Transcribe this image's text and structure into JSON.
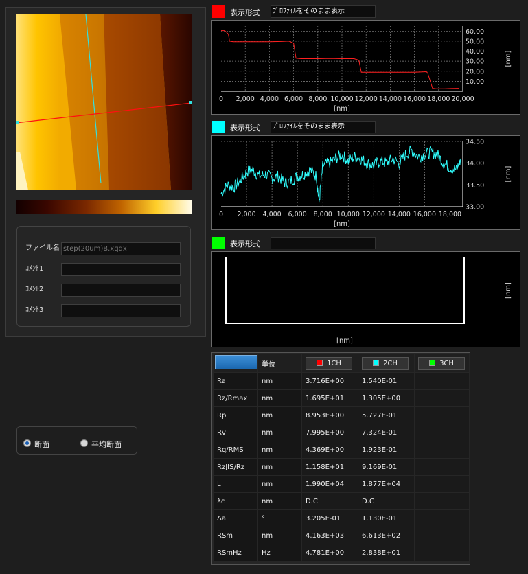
{
  "file_panel": {
    "filename_label": "ファイル名",
    "filename_value": "step(20um)B.xqdx",
    "comment1_label": "ｺﾒﾝﾄ1",
    "comment2_label": "ｺﾒﾝﾄ2",
    "comment3_label": "ｺﾒﾝﾄ3",
    "comment1_value": "",
    "comment2_value": "",
    "comment3_value": ""
  },
  "section_mode": {
    "options": [
      "断面",
      "平均断面"
    ],
    "selected": "断面"
  },
  "channels": [
    {
      "color": "#ff0000",
      "mode_label": "表示形式",
      "mode_value": "ﾌﾟﾛﾌｧｲﾙをそのまま表示",
      "unit": "[nm]",
      "x_unit": "[nm]",
      "x_ticks": [
        "0",
        "2,000",
        "4,000",
        "6,000",
        "8,000",
        "10,000",
        "12,000",
        "14,000",
        "16,000",
        "18,000",
        "20,000"
      ],
      "y_ticks": [
        "60.00",
        "50.00",
        "40.00",
        "30.00",
        "20.00",
        "10.00"
      ]
    },
    {
      "color": "#00ffff",
      "mode_label": "表示形式",
      "mode_value": "ﾌﾟﾛﾌｧｲﾙをそのまま表示",
      "unit": "[nm]",
      "x_unit": "[nm]",
      "x_ticks": [
        "0",
        "2,000",
        "4,000",
        "6,000",
        "8,000",
        "10,000",
        "12,000",
        "14,000",
        "16,000",
        "18,000"
      ],
      "y_ticks": [
        "34.50",
        "34.00",
        "33.50",
        "33.00"
      ]
    },
    {
      "color": "#00ff00",
      "mode_label": "表示形式",
      "mode_value": "",
      "unit": "[nm]",
      "x_unit": "[nm]"
    }
  ],
  "chart_data": [
    {
      "type": "line",
      "series": [
        {
          "x": [
            0,
            300,
            600,
            700,
            1000,
            2000,
            3000,
            4000,
            5000,
            5600,
            6000,
            6200,
            6600,
            8000,
            9000,
            10000,
            11000,
            11400,
            11600,
            12000,
            14000,
            16000,
            17000,
            17100,
            17500,
            17800,
            18500,
            19000,
            19700
          ],
          "y": [
            60.5,
            60.5,
            57,
            50,
            49.5,
            49.5,
            49.5,
            49.5,
            49.7,
            50,
            48,
            33,
            32.5,
            32.5,
            32.8,
            32.5,
            32.5,
            31,
            19,
            19,
            19,
            19,
            19.5,
            18,
            3,
            2.5,
            2.6,
            2.8,
            3
          ]
        }
      ],
      "xlim": [
        0,
        20000
      ],
      "ylim": [
        0,
        65
      ]
    },
    {
      "type": "line",
      "series": [
        {
          "x": [
            0,
            500,
            1000,
            1500,
            2000,
            2500,
            3000,
            3500,
            4000,
            4500,
            5000,
            5500,
            6000,
            6500,
            7000,
            7500,
            7700,
            8000,
            8500,
            9000,
            9500,
            10000,
            10500,
            11000,
            11500,
            12000,
            12500,
            13000,
            13500,
            14000,
            14500,
            15000,
            15500,
            16000,
            16500,
            17000,
            17500,
            18000,
            18500,
            18900
          ],
          "y": [
            33.3,
            33.5,
            33.45,
            33.6,
            33.8,
            33.85,
            33.7,
            33.75,
            33.65,
            33.7,
            33.55,
            33.6,
            33.7,
            33.75,
            33.85,
            33.7,
            33.1,
            33.95,
            34.0,
            34.1,
            34.2,
            34.05,
            34.15,
            34.1,
            34.0,
            33.95,
            34.05,
            34.0,
            34.1,
            34.0,
            34.2,
            34.3,
            34.15,
            34.2,
            34.25,
            34.2,
            34.0,
            33.9,
            33.85,
            34.1
          ]
        }
      ],
      "xlim": [
        0,
        19000
      ],
      "ylim": [
        33.0,
        34.5
      ]
    },
    {
      "type": "line",
      "series": []
    }
  ],
  "table": {
    "header": [
      "",
      "単位",
      "1CH",
      "2CH",
      "3CH"
    ],
    "header_colors": [
      "",
      "",
      "#ff0000",
      "#00ffff",
      "#00ff00"
    ],
    "rows": [
      [
        "Ra",
        "nm",
        "3.716E+00",
        "1.540E-01",
        ""
      ],
      [
        "Rz/Rmax",
        "nm",
        "1.695E+01",
        "1.305E+00",
        ""
      ],
      [
        "Rp",
        "nm",
        "8.953E+00",
        "5.727E-01",
        ""
      ],
      [
        "Rv",
        "nm",
        "7.995E+00",
        "7.324E-01",
        ""
      ],
      [
        "Rq/RMS",
        "nm",
        "4.369E+00",
        "1.923E-01",
        ""
      ],
      [
        "RzJIS/Rz",
        "nm",
        "1.158E+01",
        "9.169E-01",
        ""
      ],
      [
        "L",
        "nm",
        "1.990E+04",
        "1.877E+04",
        ""
      ],
      [
        "λc",
        "nm",
        "D.C",
        "D.C",
        ""
      ],
      [
        "Δa",
        "°",
        "3.205E-01",
        "1.130E-01",
        ""
      ],
      [
        "RSm",
        "nm",
        "4.163E+03",
        "6.613E+02",
        ""
      ],
      [
        "RSmHz",
        "Hz",
        "4.781E+00",
        "2.838E+01",
        ""
      ]
    ]
  }
}
